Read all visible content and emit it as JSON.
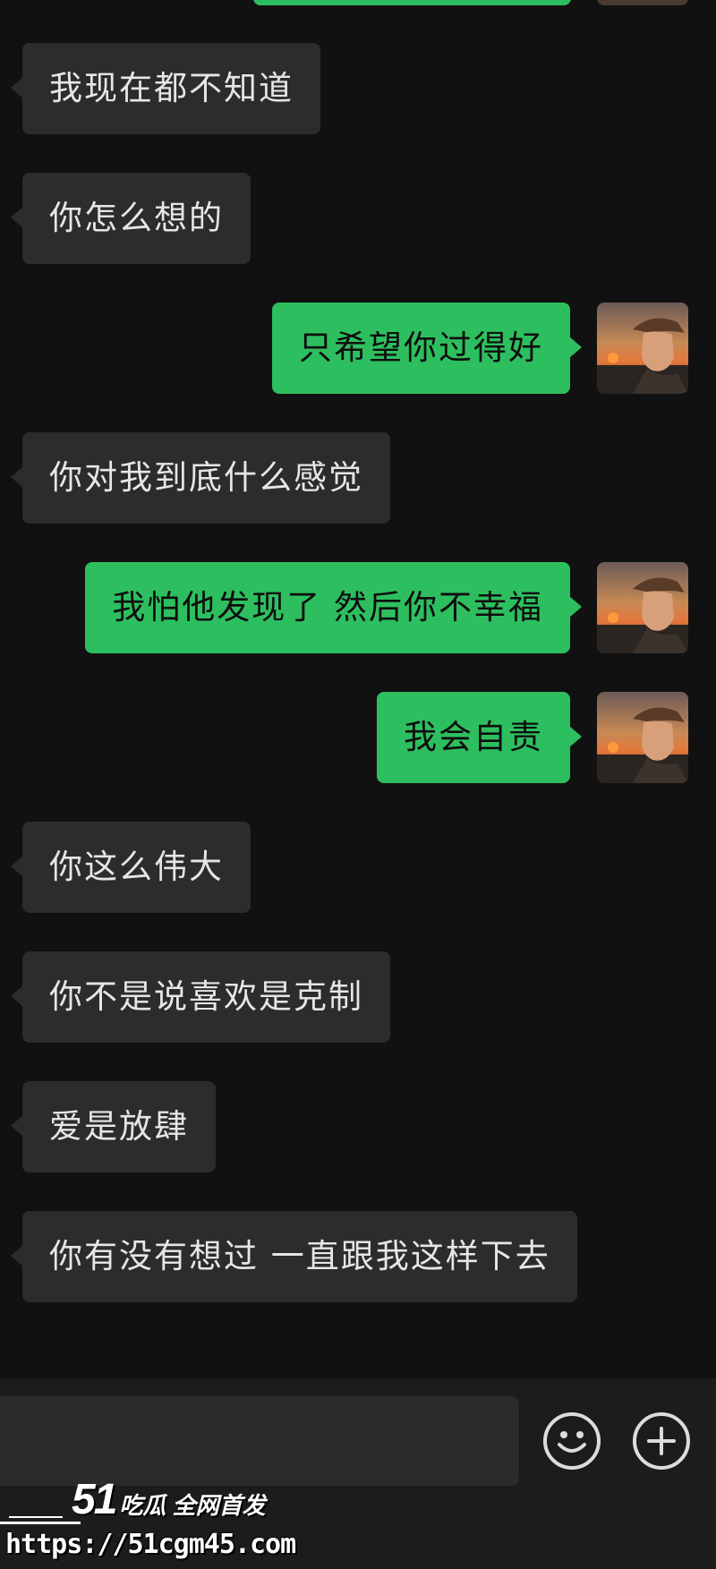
{
  "chat": {
    "messages": [
      {
        "side": "in",
        "text": "我现在都不知道"
      },
      {
        "side": "in",
        "text": "你怎么想的"
      },
      {
        "side": "out",
        "text": "只希望你过得好"
      },
      {
        "side": "in",
        "text": "你对我到底什么感觉"
      },
      {
        "side": "out",
        "text": "我怕他发现了  然后你不幸福"
      },
      {
        "side": "out",
        "text": "我会自责"
      },
      {
        "side": "in",
        "text": "你这么伟大"
      },
      {
        "side": "in",
        "text": "你不是说喜欢是克制"
      },
      {
        "side": "in",
        "text": "爱是放肆"
      },
      {
        "side": "in",
        "text": "你有没有想过 一直跟我这样下去"
      }
    ]
  },
  "input_bar": {
    "emoji_icon": "smiley-face-icon",
    "plus_icon": "plus-circle-icon"
  },
  "watermark": {
    "brand_number": "51",
    "brand_text": "吃瓜 全网首发",
    "url": "https://51cgm45.com"
  },
  "colors": {
    "background": "#111111",
    "incoming_bubble": "#2c2c2c",
    "outgoing_bubble": "#2dbf5f"
  }
}
